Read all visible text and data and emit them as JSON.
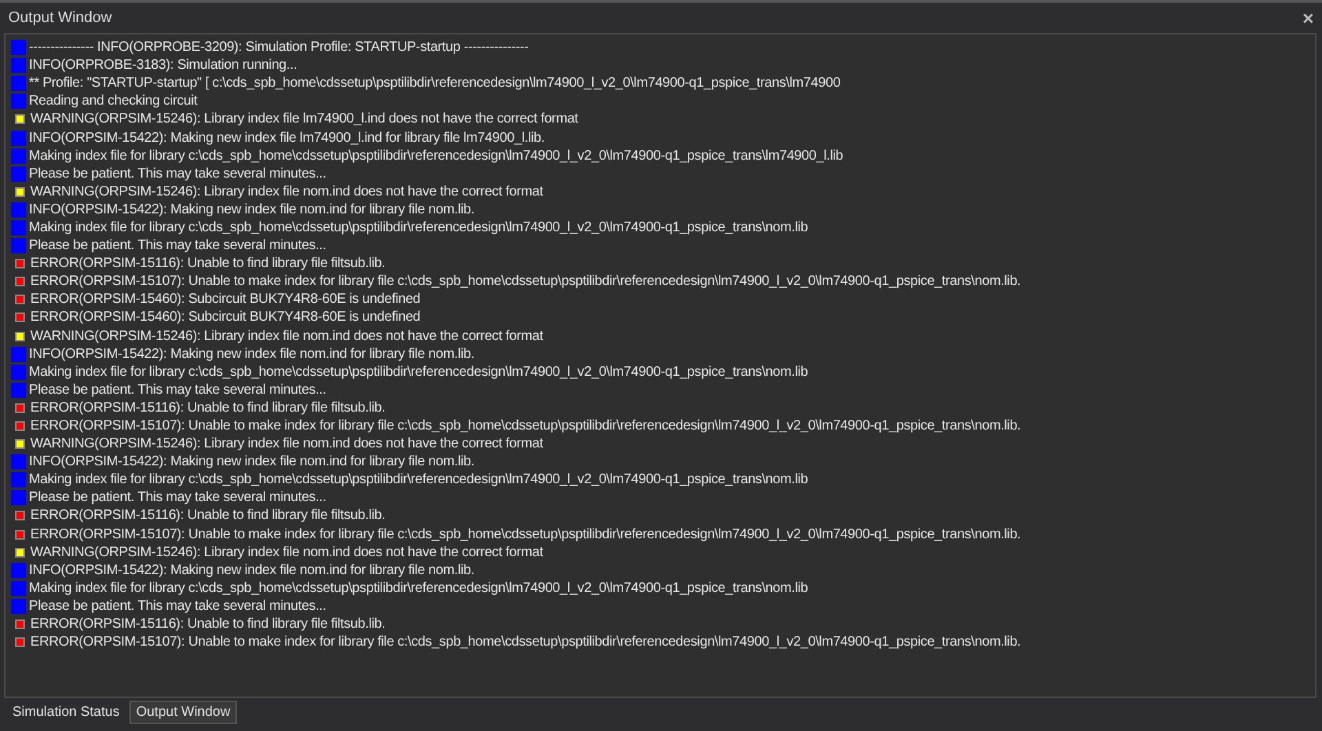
{
  "panel": {
    "title": "Output Window",
    "close": "×"
  },
  "lines": [
    {
      "kind": "info",
      "text": "--------------- INFO(ORPROBE-3209): Simulation Profile:  STARTUP-startup ---------------"
    },
    {
      "kind": "info",
      "text": "INFO(ORPROBE-3183): Simulation running..."
    },
    {
      "kind": "info",
      "text": "** Profile: \"STARTUP-startup\"  [ c:\\cds_spb_home\\cdssetup\\psptilibdir\\referencedesign\\lm74900_l_v2_0\\lm74900-q1_pspice_trans\\lm74900"
    },
    {
      "kind": "info",
      "text": "Reading and checking circuit"
    },
    {
      "kind": "warning",
      "text": "WARNING(ORPSIM-15246): Library index file lm74900_l.ind does not have the correct format"
    },
    {
      "kind": "info",
      "text": "INFO(ORPSIM-15422): Making new index file lm74900_l.ind for library file lm74900_l.lib."
    },
    {
      "kind": "info",
      "text": "Making index file for library c:\\cds_spb_home\\cdssetup\\psptilibdir\\referencedesign\\lm74900_l_v2_0\\lm74900-q1_pspice_trans\\lm74900_l.lib"
    },
    {
      "kind": "info",
      "text": "Please be patient. This may take several minutes..."
    },
    {
      "kind": "warning",
      "text": "WARNING(ORPSIM-15246): Library index file nom.ind does not have the correct format"
    },
    {
      "kind": "info",
      "text": "INFO(ORPSIM-15422): Making new index file nom.ind for library file nom.lib."
    },
    {
      "kind": "info",
      "text": "Making index file for library c:\\cds_spb_home\\cdssetup\\psptilibdir\\referencedesign\\lm74900_l_v2_0\\lm74900-q1_pspice_trans\\nom.lib"
    },
    {
      "kind": "info",
      "text": "Please be patient. This may take several minutes..."
    },
    {
      "kind": "error",
      "text": "ERROR(ORPSIM-15116): Unable to find library file filtsub.lib."
    },
    {
      "kind": "error",
      "text": "ERROR(ORPSIM-15107): Unable to make index for library file c:\\cds_spb_home\\cdssetup\\psptilibdir\\referencedesign\\lm74900_l_v2_0\\lm74900-q1_pspice_trans\\nom.lib."
    },
    {
      "kind": "error",
      "text": "ERROR(ORPSIM-15460): Subcircuit BUK7Y4R8-60E is undefined"
    },
    {
      "kind": "error",
      "text": "ERROR(ORPSIM-15460): Subcircuit BUK7Y4R8-60E is undefined"
    },
    {
      "kind": "warning",
      "text": "WARNING(ORPSIM-15246): Library index file nom.ind does not have the correct format"
    },
    {
      "kind": "info",
      "text": "INFO(ORPSIM-15422): Making new index file nom.ind for library file nom.lib."
    },
    {
      "kind": "info",
      "text": "Making index file for library c:\\cds_spb_home\\cdssetup\\psptilibdir\\referencedesign\\lm74900_l_v2_0\\lm74900-q1_pspice_trans\\nom.lib"
    },
    {
      "kind": "info",
      "text": "Please be patient. This may take several minutes..."
    },
    {
      "kind": "error",
      "text": "ERROR(ORPSIM-15116): Unable to find library file filtsub.lib."
    },
    {
      "kind": "error",
      "text": "ERROR(ORPSIM-15107): Unable to make index for library file c:\\cds_spb_home\\cdssetup\\psptilibdir\\referencedesign\\lm74900_l_v2_0\\lm74900-q1_pspice_trans\\nom.lib."
    },
    {
      "kind": "warning",
      "text": "WARNING(ORPSIM-15246): Library index file nom.ind does not have the correct format"
    },
    {
      "kind": "info",
      "text": "INFO(ORPSIM-15422): Making new index file nom.ind for library file nom.lib."
    },
    {
      "kind": "info",
      "text": "Making index file for library c:\\cds_spb_home\\cdssetup\\psptilibdir\\referencedesign\\lm74900_l_v2_0\\lm74900-q1_pspice_trans\\nom.lib"
    },
    {
      "kind": "info",
      "text": "Please be patient. This may take several minutes..."
    },
    {
      "kind": "error",
      "text": "ERROR(ORPSIM-15116): Unable to find library file filtsub.lib."
    },
    {
      "kind": "error",
      "text": "ERROR(ORPSIM-15107): Unable to make index for library file c:\\cds_spb_home\\cdssetup\\psptilibdir\\referencedesign\\lm74900_l_v2_0\\lm74900-q1_pspice_trans\\nom.lib."
    },
    {
      "kind": "warning",
      "text": "WARNING(ORPSIM-15246): Library index file nom.ind does not have the correct format"
    },
    {
      "kind": "info",
      "text": "INFO(ORPSIM-15422): Making new index file nom.ind for library file nom.lib."
    },
    {
      "kind": "info",
      "text": "Making index file for library c:\\cds_spb_home\\cdssetup\\psptilibdir\\referencedesign\\lm74900_l_v2_0\\lm74900-q1_pspice_trans\\nom.lib"
    },
    {
      "kind": "info",
      "text": "Please be patient. This may take several minutes..."
    },
    {
      "kind": "error",
      "text": "ERROR(ORPSIM-15116): Unable to find library file filtsub.lib."
    },
    {
      "kind": "error",
      "text": "ERROR(ORPSIM-15107): Unable to make index for library file c:\\cds_spb_home\\cdssetup\\psptilibdir\\referencedesign\\lm74900_l_v2_0\\lm74900-q1_pspice_trans\\nom.lib."
    }
  ],
  "tabs": [
    {
      "label": "Simulation Status",
      "selected": false
    },
    {
      "label": "Output Window",
      "selected": true
    }
  ]
}
